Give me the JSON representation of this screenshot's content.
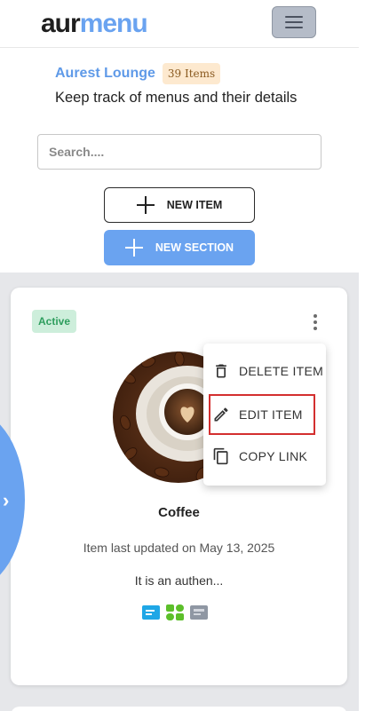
{
  "header": {
    "logo_part1": "aur",
    "logo_part2": "menu",
    "menu_button_icon": "hamburger-icon"
  },
  "venue": {
    "name": "Aurest Lounge",
    "item_count": "39 Items",
    "subtitle": "Keep track of menus and their details"
  },
  "search": {
    "placeholder": "Search....",
    "value": ""
  },
  "actions": {
    "new_item_label": "NEW ITEM",
    "new_section_label": "NEW SECTION"
  },
  "card": {
    "status": "Active",
    "item_name": "Coffee",
    "updated": "Item last updated on May 13, 2025",
    "description": "It is an authen...",
    "icons": [
      "blue-card-icon",
      "green-grid-icon",
      "gray-folder-icon"
    ]
  },
  "menu": {
    "items": [
      {
        "label": "DELETE ITEM",
        "icon": "trash-icon"
      },
      {
        "label": "EDIT ITEM",
        "icon": "pencil-icon"
      },
      {
        "label": "COPY LINK",
        "icon": "copy-icon"
      }
    ],
    "highlighted": "EDIT ITEM"
  },
  "colors": {
    "brand_blue": "#6aa3f0",
    "active_green": "#2e9e5e",
    "highlight_red": "#d32f2f",
    "badge_bg": "#fde9cf"
  }
}
